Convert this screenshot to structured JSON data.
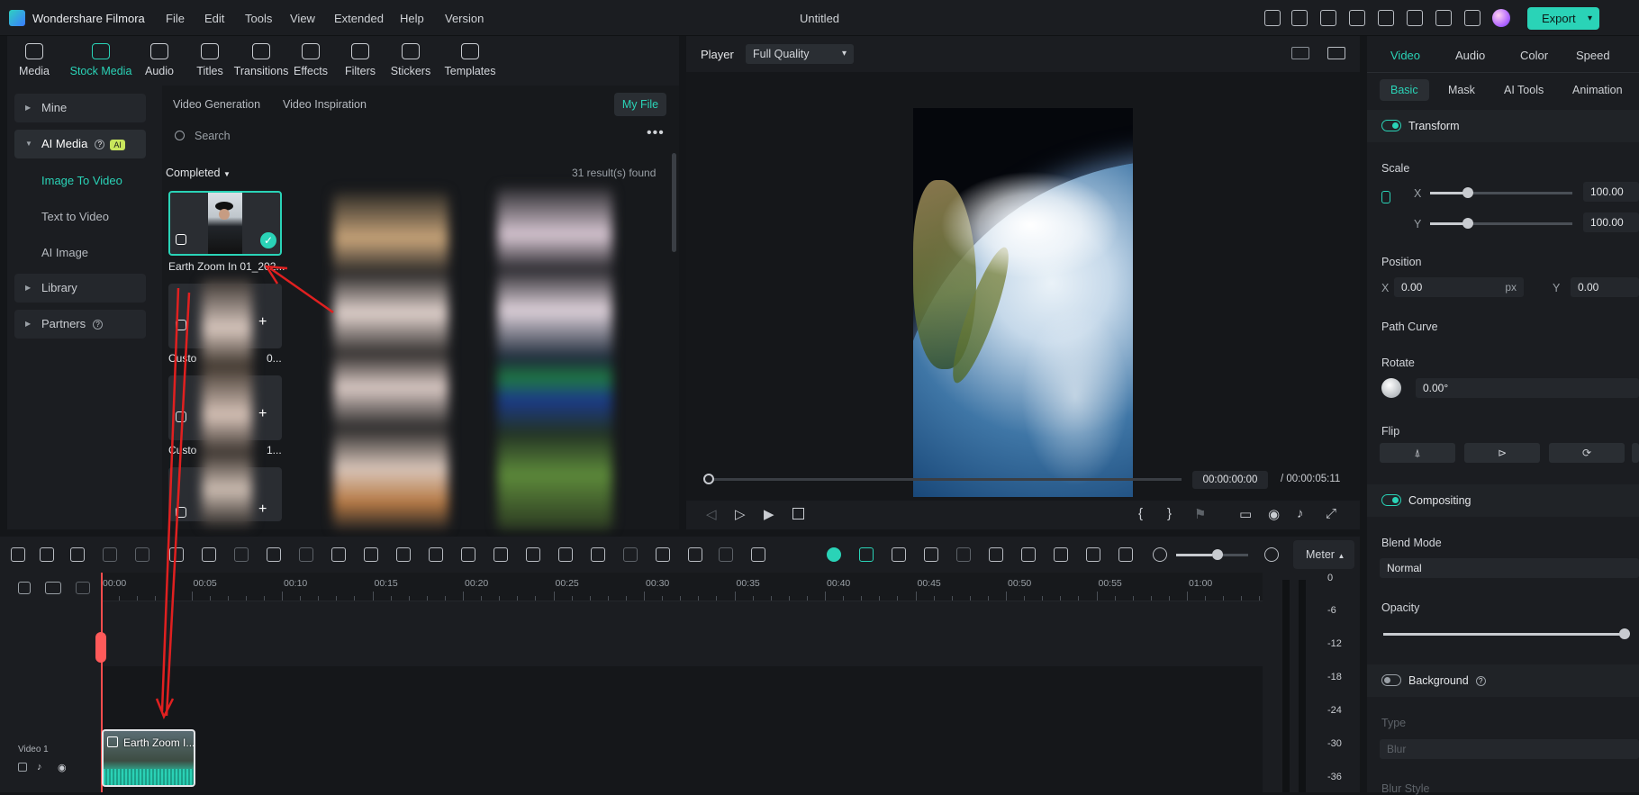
{
  "app": {
    "name": "Wondershare Filmora",
    "title": "Untitled",
    "menu": [
      "File",
      "Edit",
      "Tools",
      "View",
      "Extended",
      "Help",
      "Version"
    ],
    "export_label": "Export"
  },
  "media_tabs": [
    "Media",
    "Stock Media",
    "Audio",
    "Titles",
    "Transitions",
    "Effects",
    "Filters",
    "Stickers",
    "Templates"
  ],
  "media_tabs_active": "Stock Media",
  "sidebar": {
    "mine": "Mine",
    "ai_media": "AI Media",
    "ai_badge": "AI",
    "sub": [
      "Image To Video",
      "Text to Video",
      "AI Image"
    ],
    "library": "Library",
    "partners": "Partners"
  },
  "media": {
    "subtabs": [
      "Video Generation",
      "Video Inspiration"
    ],
    "my_file": "My File",
    "search_placeholder": "Search",
    "completed": "Completed",
    "results": "31 result(s) found",
    "items": [
      {
        "label": "Earth Zoom In 01_202..."
      },
      {
        "label": "Custo"
      },
      {
        "label": "0..."
      },
      {
        "label": "Custo"
      },
      {
        "label": "1..."
      }
    ]
  },
  "player": {
    "label": "Player",
    "quality": "Full Quality",
    "current_time": "00:00:00:00",
    "total_time": "/ 00:00:05:11"
  },
  "props": {
    "tabs": [
      "Video",
      "Audio",
      "Color",
      "Speed"
    ],
    "subtabs": [
      "Basic",
      "Mask",
      "AI Tools",
      "Animation"
    ],
    "transform": "Transform",
    "scale": "Scale",
    "x": "X",
    "y": "Y",
    "scale_x": "100.00",
    "scale_y": "100.00",
    "position": "Position",
    "pos_x": "0.00",
    "pos_y": "0.00",
    "px": "px",
    "path_curve": "Path Curve",
    "rotate": "Rotate",
    "rotate_val": "0.00°",
    "flip": "Flip",
    "compositing": "Compositing",
    "blend_mode": "Blend Mode",
    "blend_val": "Normal",
    "opacity": "Opacity",
    "background": "Background",
    "type": "Type",
    "type_val": "Blur",
    "blur_style": "Blur Style"
  },
  "timeline": {
    "meter": "Meter",
    "ruler": [
      "00:00",
      "00:05",
      "00:10",
      "00:15",
      "00:20",
      "00:25",
      "00:30",
      "00:35",
      "00:40",
      "00:45",
      "00:50",
      "00:55",
      "01:00"
    ],
    "meter_labels": [
      "0",
      "-6",
      "-12",
      "-18",
      "-24",
      "-30",
      "-36"
    ],
    "track_label": "Video 1",
    "clip_title": "Earth Zoom I..."
  },
  "colors": {
    "accent": "#2ad3b7",
    "annotation": "#e02020"
  }
}
